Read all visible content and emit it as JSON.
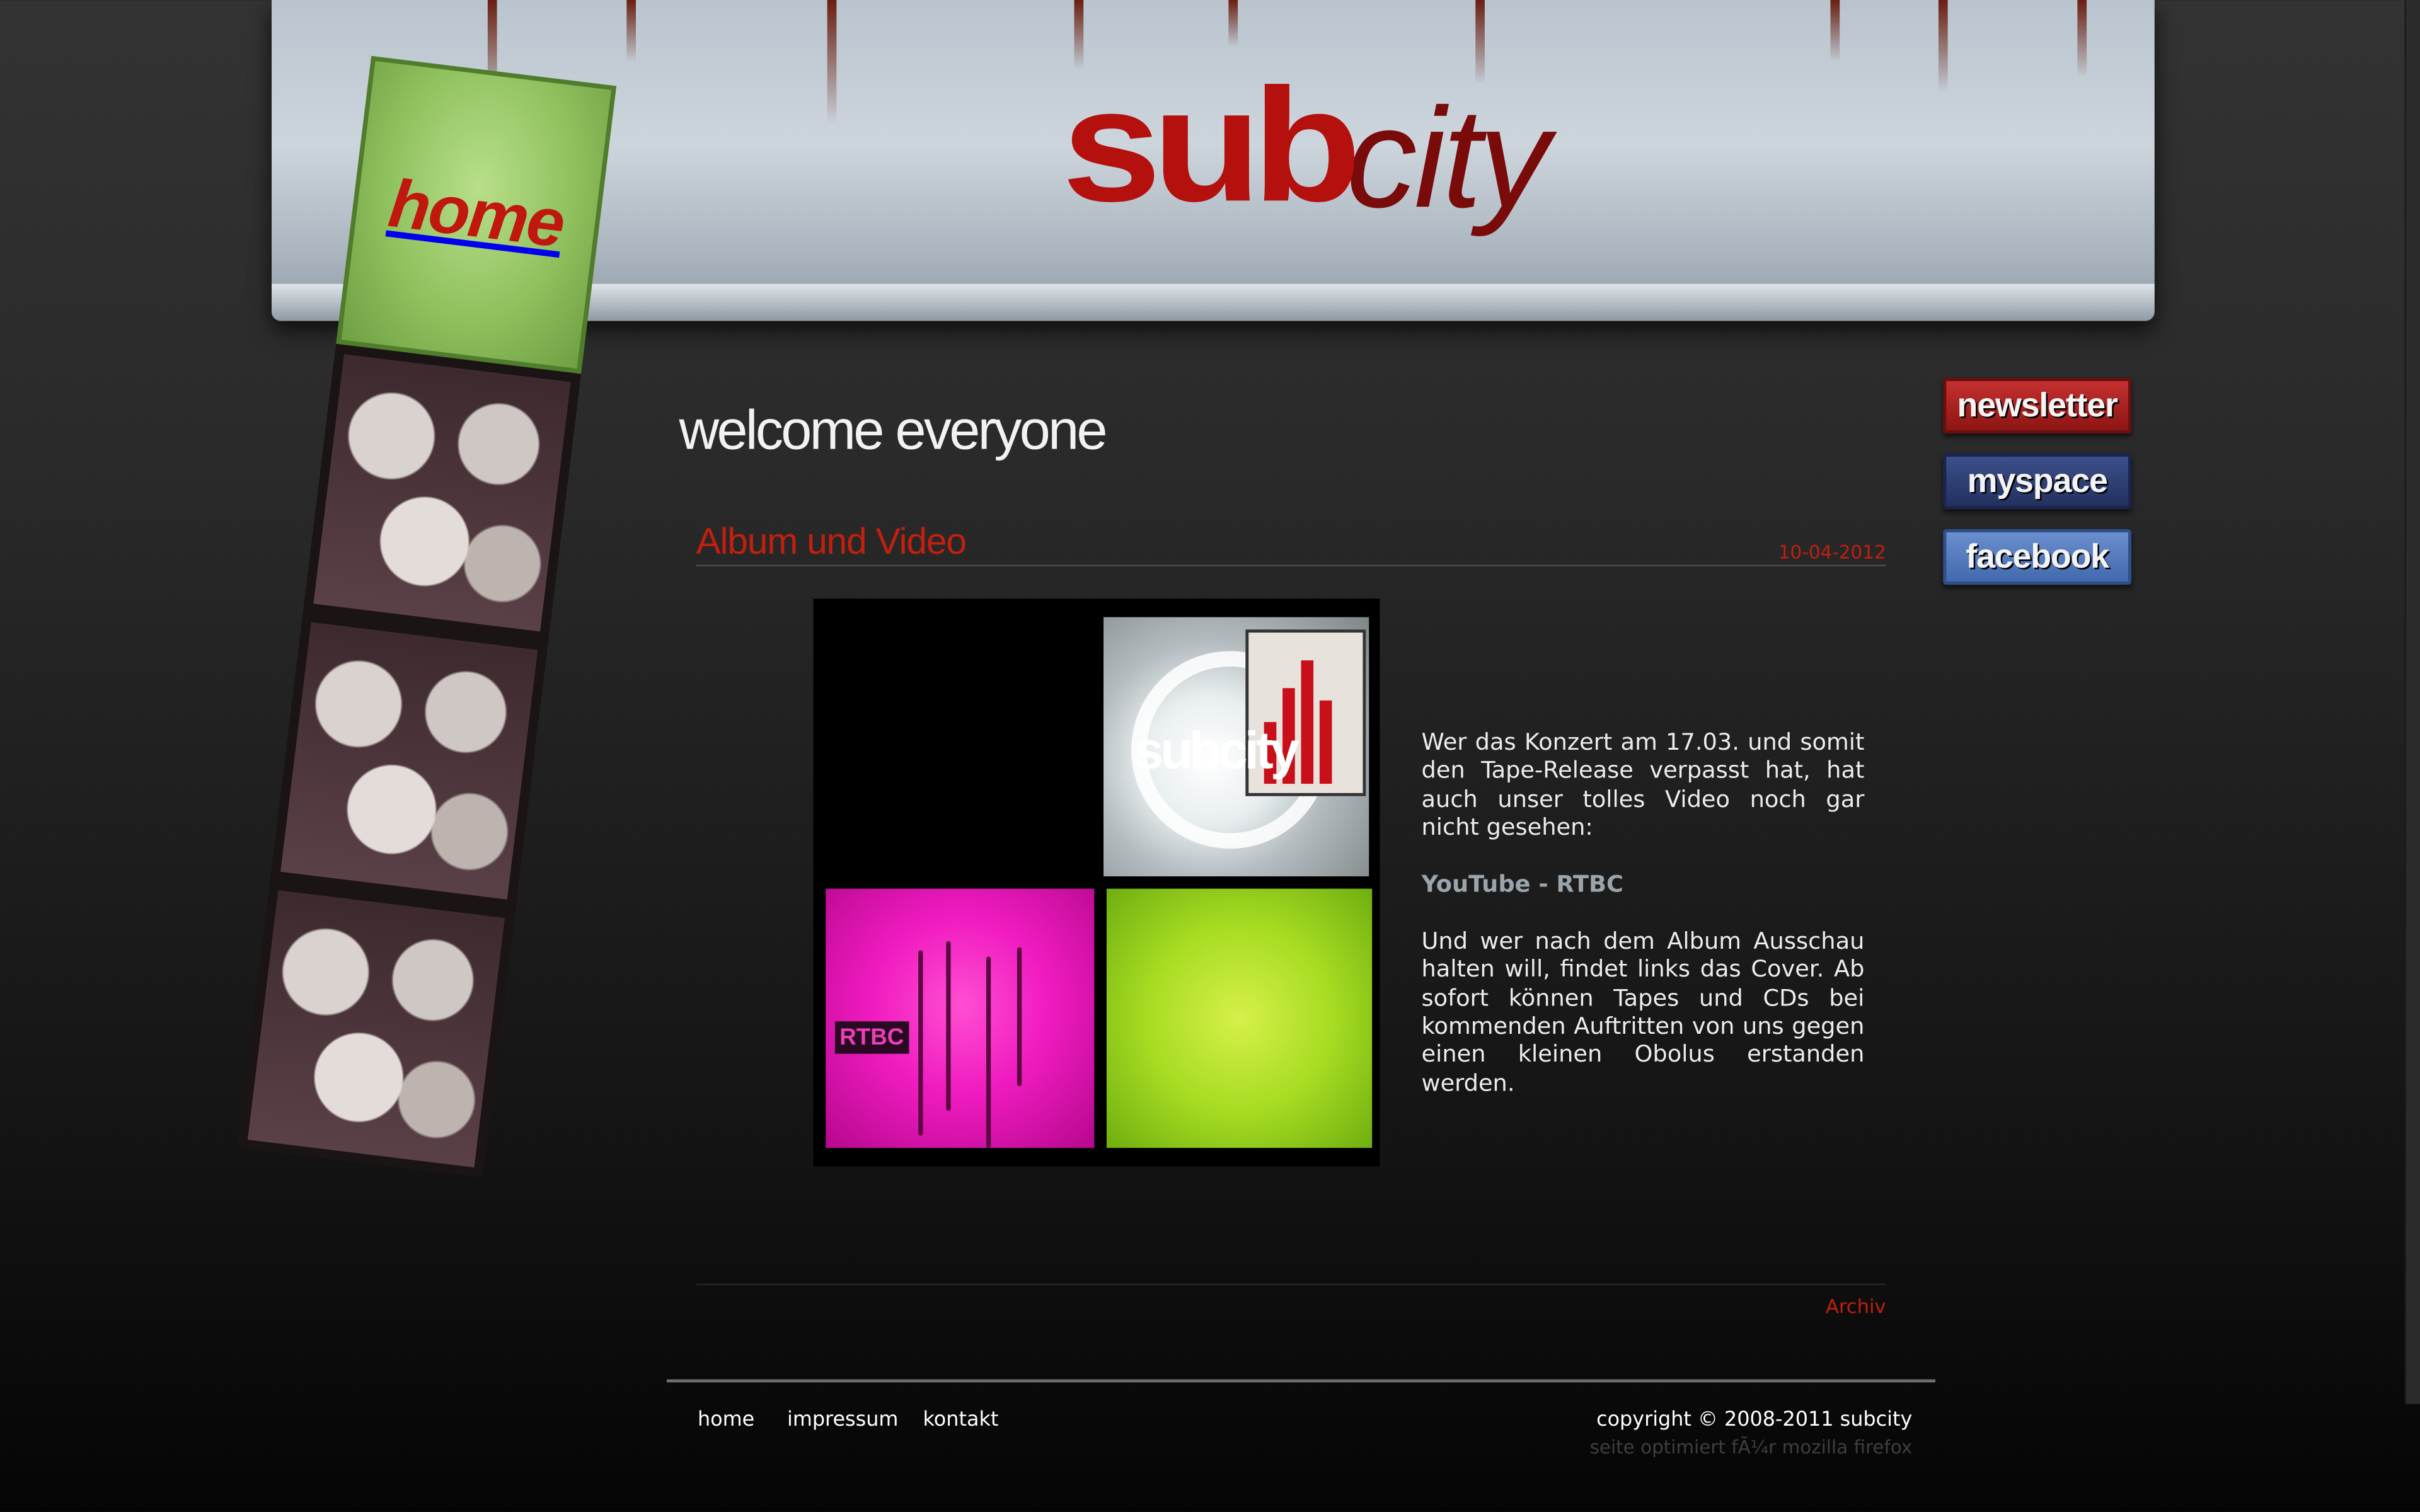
{
  "header": {
    "logo_sub": "sub",
    "logo_city": "city"
  },
  "nav": {
    "home_tab_label": "home"
  },
  "main": {
    "heading": "welcome everyone",
    "post": {
      "title": "Album und Video",
      "date": "10-04-2012",
      "cover": {
        "brand_word": "subcity",
        "tag": "RTBC"
      },
      "paragraph_1": "Wer das Konzert am 17.03. und somit den Tape-Release verpasst hat, hat auch unser tolles Video noch gar nicht gesehen:",
      "link_label": "YouTube - RTBC",
      "paragraph_2": "Und wer nach dem Album Ausschau halten will, findet links das Cover. Ab sofort können Tapes und CDs bei kommenden Auftritten von uns gegen einen kleinen Obolus erstanden werden."
    },
    "archive_label": "Archiv"
  },
  "social": {
    "newsletter": "newsletter",
    "myspace": "myspace",
    "facebook": "facebook"
  },
  "footer": {
    "links": [
      "home",
      "impressum",
      "kontakt"
    ],
    "copyright": "copyright © 2008-2011 subcity",
    "optimized": "seite optimiert fÃ¼r mozilla firefox"
  },
  "colors": {
    "accent_red": "#c0200f",
    "newsletter_bg": "#b02623",
    "myspace_bg": "#2f3f75",
    "facebook_bg": "#5a80c0",
    "home_tab_green": "#8fc15e"
  }
}
